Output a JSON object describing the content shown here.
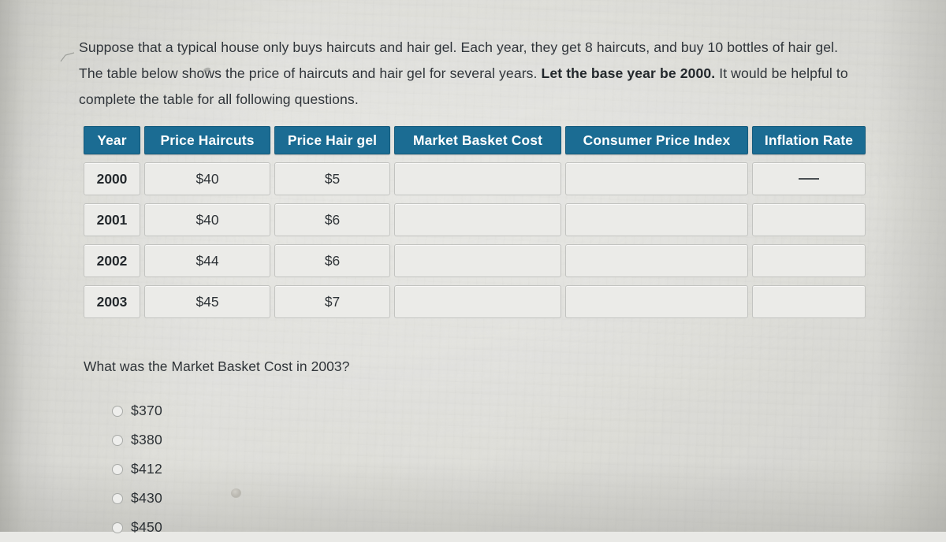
{
  "prompt": {
    "part1": "Suppose that a typical house only buys haircuts and hair gel. Each year, they get 8 haircuts, and buy 10 bottles of hair gel.  The table below shows the price of haircuts and hair gel for several years.  ",
    "emphasis": "Let the base year be 2000.",
    "part2": " It would be helpful to complete the table for all following questions."
  },
  "table": {
    "columns": [
      "Year",
      "Price Haircuts",
      "Price Hair gel",
      "Market Basket Cost",
      "Consumer Price Index",
      "Inflation Rate"
    ],
    "rows": [
      {
        "year": "2000",
        "price_haircuts": "$40",
        "price_hair_gel": "$5",
        "market_basket_cost": "",
        "consumer_price_index": "",
        "inflation_rate": "—"
      },
      {
        "year": "2001",
        "price_haircuts": "$40",
        "price_hair_gel": "$6",
        "market_basket_cost": "",
        "consumer_price_index": "",
        "inflation_rate": ""
      },
      {
        "year": "2002",
        "price_haircuts": "$44",
        "price_hair_gel": "$6",
        "market_basket_cost": "",
        "consumer_price_index": "",
        "inflation_rate": ""
      },
      {
        "year": "2003",
        "price_haircuts": "$45",
        "price_hair_gel": "$7",
        "market_basket_cost": "",
        "consumer_price_index": "",
        "inflation_rate": ""
      }
    ]
  },
  "question": {
    "text": "What was the Market Basket Cost in 2003?",
    "options": [
      {
        "label": "$370",
        "selected": false
      },
      {
        "label": "$380",
        "selected": false
      },
      {
        "label": "$412",
        "selected": false
      },
      {
        "label": "$430",
        "selected": false
      },
      {
        "label": "$450",
        "selected": false
      }
    ]
  },
  "colors": {
    "header_background": "#1b6c93",
    "header_text": "#ffffff",
    "cell_background": "#ebebe8",
    "cell_border": "#c2c3c0",
    "page_background": "#e9e9e6",
    "body_text": "#2f3438"
  }
}
